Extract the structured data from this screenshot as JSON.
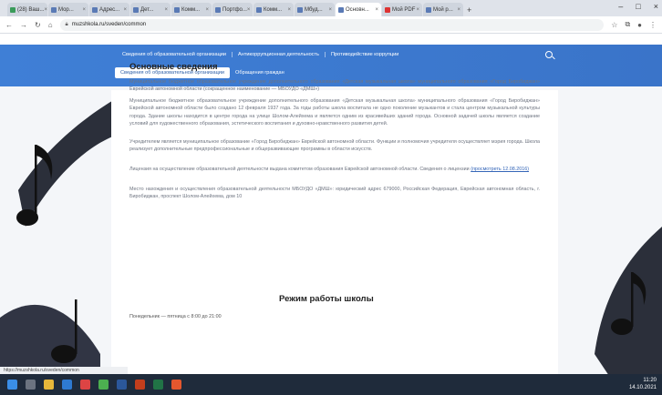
{
  "browser": {
    "tabs": [
      {
        "label": "(28) Ваш..."
      },
      {
        "label": "Мор..."
      },
      {
        "label": "Адрес..."
      },
      {
        "label": "Дет..."
      },
      {
        "label": "Комм..."
      },
      {
        "label": "Портфо..."
      },
      {
        "label": "Комм..."
      },
      {
        "label": "Мбуд..."
      },
      {
        "label": "Основн..."
      },
      {
        "label": "Мой PDF"
      },
      {
        "label": "Мой p..."
      }
    ],
    "address": "muzshkola.ru/sveden/common"
  },
  "site": {
    "menu_top": [
      "Сведения об образовательной организации",
      "Антикоррупционная деятельность",
      "Противодействие коррупции"
    ],
    "menu_active": "Сведения об образовательной организации",
    "menu_second": "Обращения граждан"
  },
  "content": {
    "heading": "Основные сведения",
    "p1": "Муниципальное бюджетное образовательное учреждение дополнительного образования «Детская музыкальная школа» муниципального образования «Город Биробиджан» Еврейской автономной области (сокращенное наименование — МБОУДО «ДМШ»)",
    "p2": "Муниципальное бюджетное образовательное учреждение дополнительного образования «Детская музыкальная школа» муниципального образования «Город Биробиджан» Еврейской автономной области было создано 12 февраля 1937 года. За годы работы школа воспитала не одно поколение музыкантов и стала центром музыкальной культуры города. Здание школы находится в центре города на улице Шолом-Алейхема и является одним из красивейших зданий города. Основной задачей школы является создание условий для художественного образования, эстетического воспитания и духовно-нравственного развития детей.",
    "p3": "Учредителем является муниципальное образование «Город Биробиджан» Еврейской автономной области. Функции и полномочия учредителя осуществляет мэрия города. Школа реализует дополнительные предпрофессиональные и общеразвивающие программы в области искусств.",
    "p4": "Лицензия на осуществление образовательной деятельности выдана комитетом образования Еврейской автономной области. Сведения о лицензии",
    "p4_link": "(просмотреть 12.08.2016)",
    "p5": "Место нахождения и осуществления образовательной деятельности МБОУДО «ДМШ»: юридический адрес 679000, Российская Федерация, Еврейская автономная область, г. Биробиджан, проспект Шолом-Алейхема, дом 10",
    "schedule_heading": "Режим работы школы",
    "hours": "Понедельник — пятница с 8:00 до 21:00"
  },
  "status": {
    "hover_url": "https://muzshkola.ru/sveden/common",
    "time": "11:20",
    "date": "14.10.2021"
  }
}
